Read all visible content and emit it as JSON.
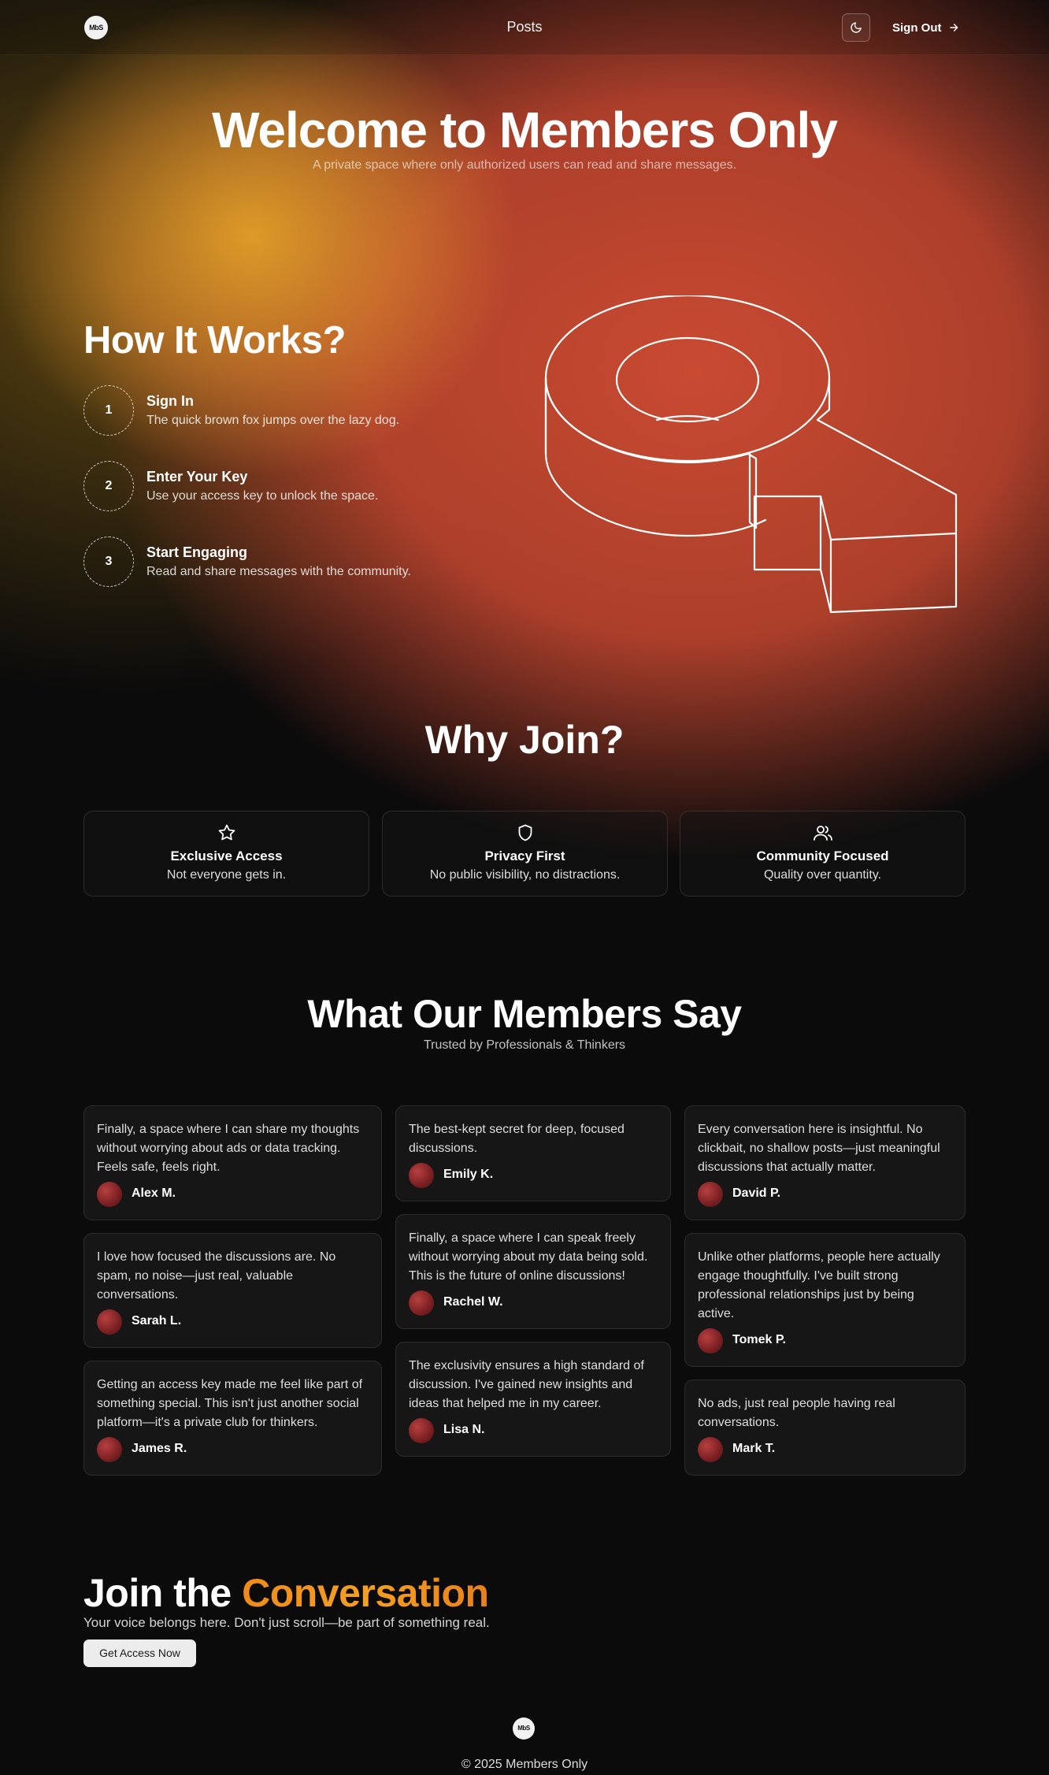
{
  "header": {
    "logo_text": "MbS",
    "nav_posts": "Posts",
    "signout_label": "Sign Out"
  },
  "hero": {
    "title": "Welcome to Members Only",
    "subtitle": "A private space where only authorized users can read and share messages."
  },
  "how": {
    "title": "How It Works?",
    "steps": [
      {
        "num": "1",
        "title": "Sign In",
        "desc": "The quick brown fox jumps over the lazy dog."
      },
      {
        "num": "2",
        "title": "Enter Your Key",
        "desc": "Use your access key to unlock the space."
      },
      {
        "num": "3",
        "title": "Start Engaging",
        "desc": "Read and share messages with the community."
      }
    ]
  },
  "why": {
    "title": "Why Join?",
    "cards": [
      {
        "icon": "star-icon",
        "title": "Exclusive Access",
        "desc": "Not everyone gets in."
      },
      {
        "icon": "shield-icon",
        "title": "Privacy First",
        "desc": "No public visibility, no distractions."
      },
      {
        "icon": "users-icon",
        "title": "Community Focused",
        "desc": "Quality over quantity."
      }
    ]
  },
  "testimonials": {
    "title": "What Our Members Say",
    "subtitle": "Trusted by Professionals & Thinkers",
    "items": [
      {
        "quote": "Finally, a space where I can share my thoughts without worrying about ads or data tracking. Feels safe, feels right.",
        "name": "Alex M."
      },
      {
        "quote": "I love how focused the discussions are. No spam, no noise—just real, valuable conversations.",
        "name": "Sarah L."
      },
      {
        "quote": "Getting an access key made me feel like part of something special. This isn't just another social platform—it's a private club for thinkers.",
        "name": "James R."
      },
      {
        "quote": "The best-kept secret for deep, focused discussions.",
        "name": "Emily K."
      },
      {
        "quote": "Finally, a space where I can speak freely without worrying about my data being sold. This is the future of online discussions!",
        "name": "Rachel W."
      },
      {
        "quote": "The exclusivity ensures a high standard of discussion. I've gained new insights and ideas that helped me in my career.",
        "name": "Lisa N."
      },
      {
        "quote": "Every conversation here is insightful. No clickbait, no shallow posts—just meaningful discussions that actually matter.",
        "name": "David P."
      },
      {
        "quote": "Unlike other platforms, people here actually engage thoughtfully. I've built strong professional relationships just by being active.",
        "name": "Tomek P."
      },
      {
        "quote": "No ads, just real people having real conversations.",
        "name": "Mark T."
      }
    ]
  },
  "join": {
    "title_plain": "Join the",
    "title_accent": "Conversation",
    "subtitle": "Your voice belongs here. Don't just scroll—be part of something real.",
    "button_label": "Get Access Now"
  },
  "footer": {
    "logo_text": "MbS",
    "copyright": "© 2025 Members Only"
  },
  "colors": {
    "accent_orange": "#f5a021",
    "hero_red": "#cd4b32",
    "hero_gold": "#e2a028",
    "background": "#0b0b0b"
  }
}
